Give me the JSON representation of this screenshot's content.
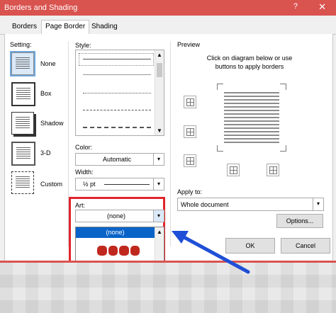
{
  "window": {
    "title": "Borders and Shading",
    "help": "?",
    "close": "✕"
  },
  "tabs": [
    "Borders",
    "Page Border",
    "Shading"
  ],
  "setting": {
    "label": "Setting:",
    "options": [
      "None",
      "Box",
      "Shadow",
      "3-D",
      "Custom"
    ]
  },
  "style": {
    "label": "Style:"
  },
  "color": {
    "label": "Color:",
    "value": "Automatic"
  },
  "width": {
    "label": "Width:",
    "value": "½ pt"
  },
  "art": {
    "label": "Art:",
    "value": "(none)",
    "list_selected": "(none)"
  },
  "preview": {
    "label": "Preview",
    "instructions": "Click on diagram below or use buttons to apply borders"
  },
  "apply_to": {
    "label": "Apply to:",
    "value": "Whole document"
  },
  "buttons": {
    "options": "Options...",
    "ok": "OK",
    "cancel": "Cancel"
  },
  "colors": {
    "highlight_red": "#e0252b",
    "arrow_blue": "#1f4fd6",
    "selection_blue": "#0a64c8"
  }
}
